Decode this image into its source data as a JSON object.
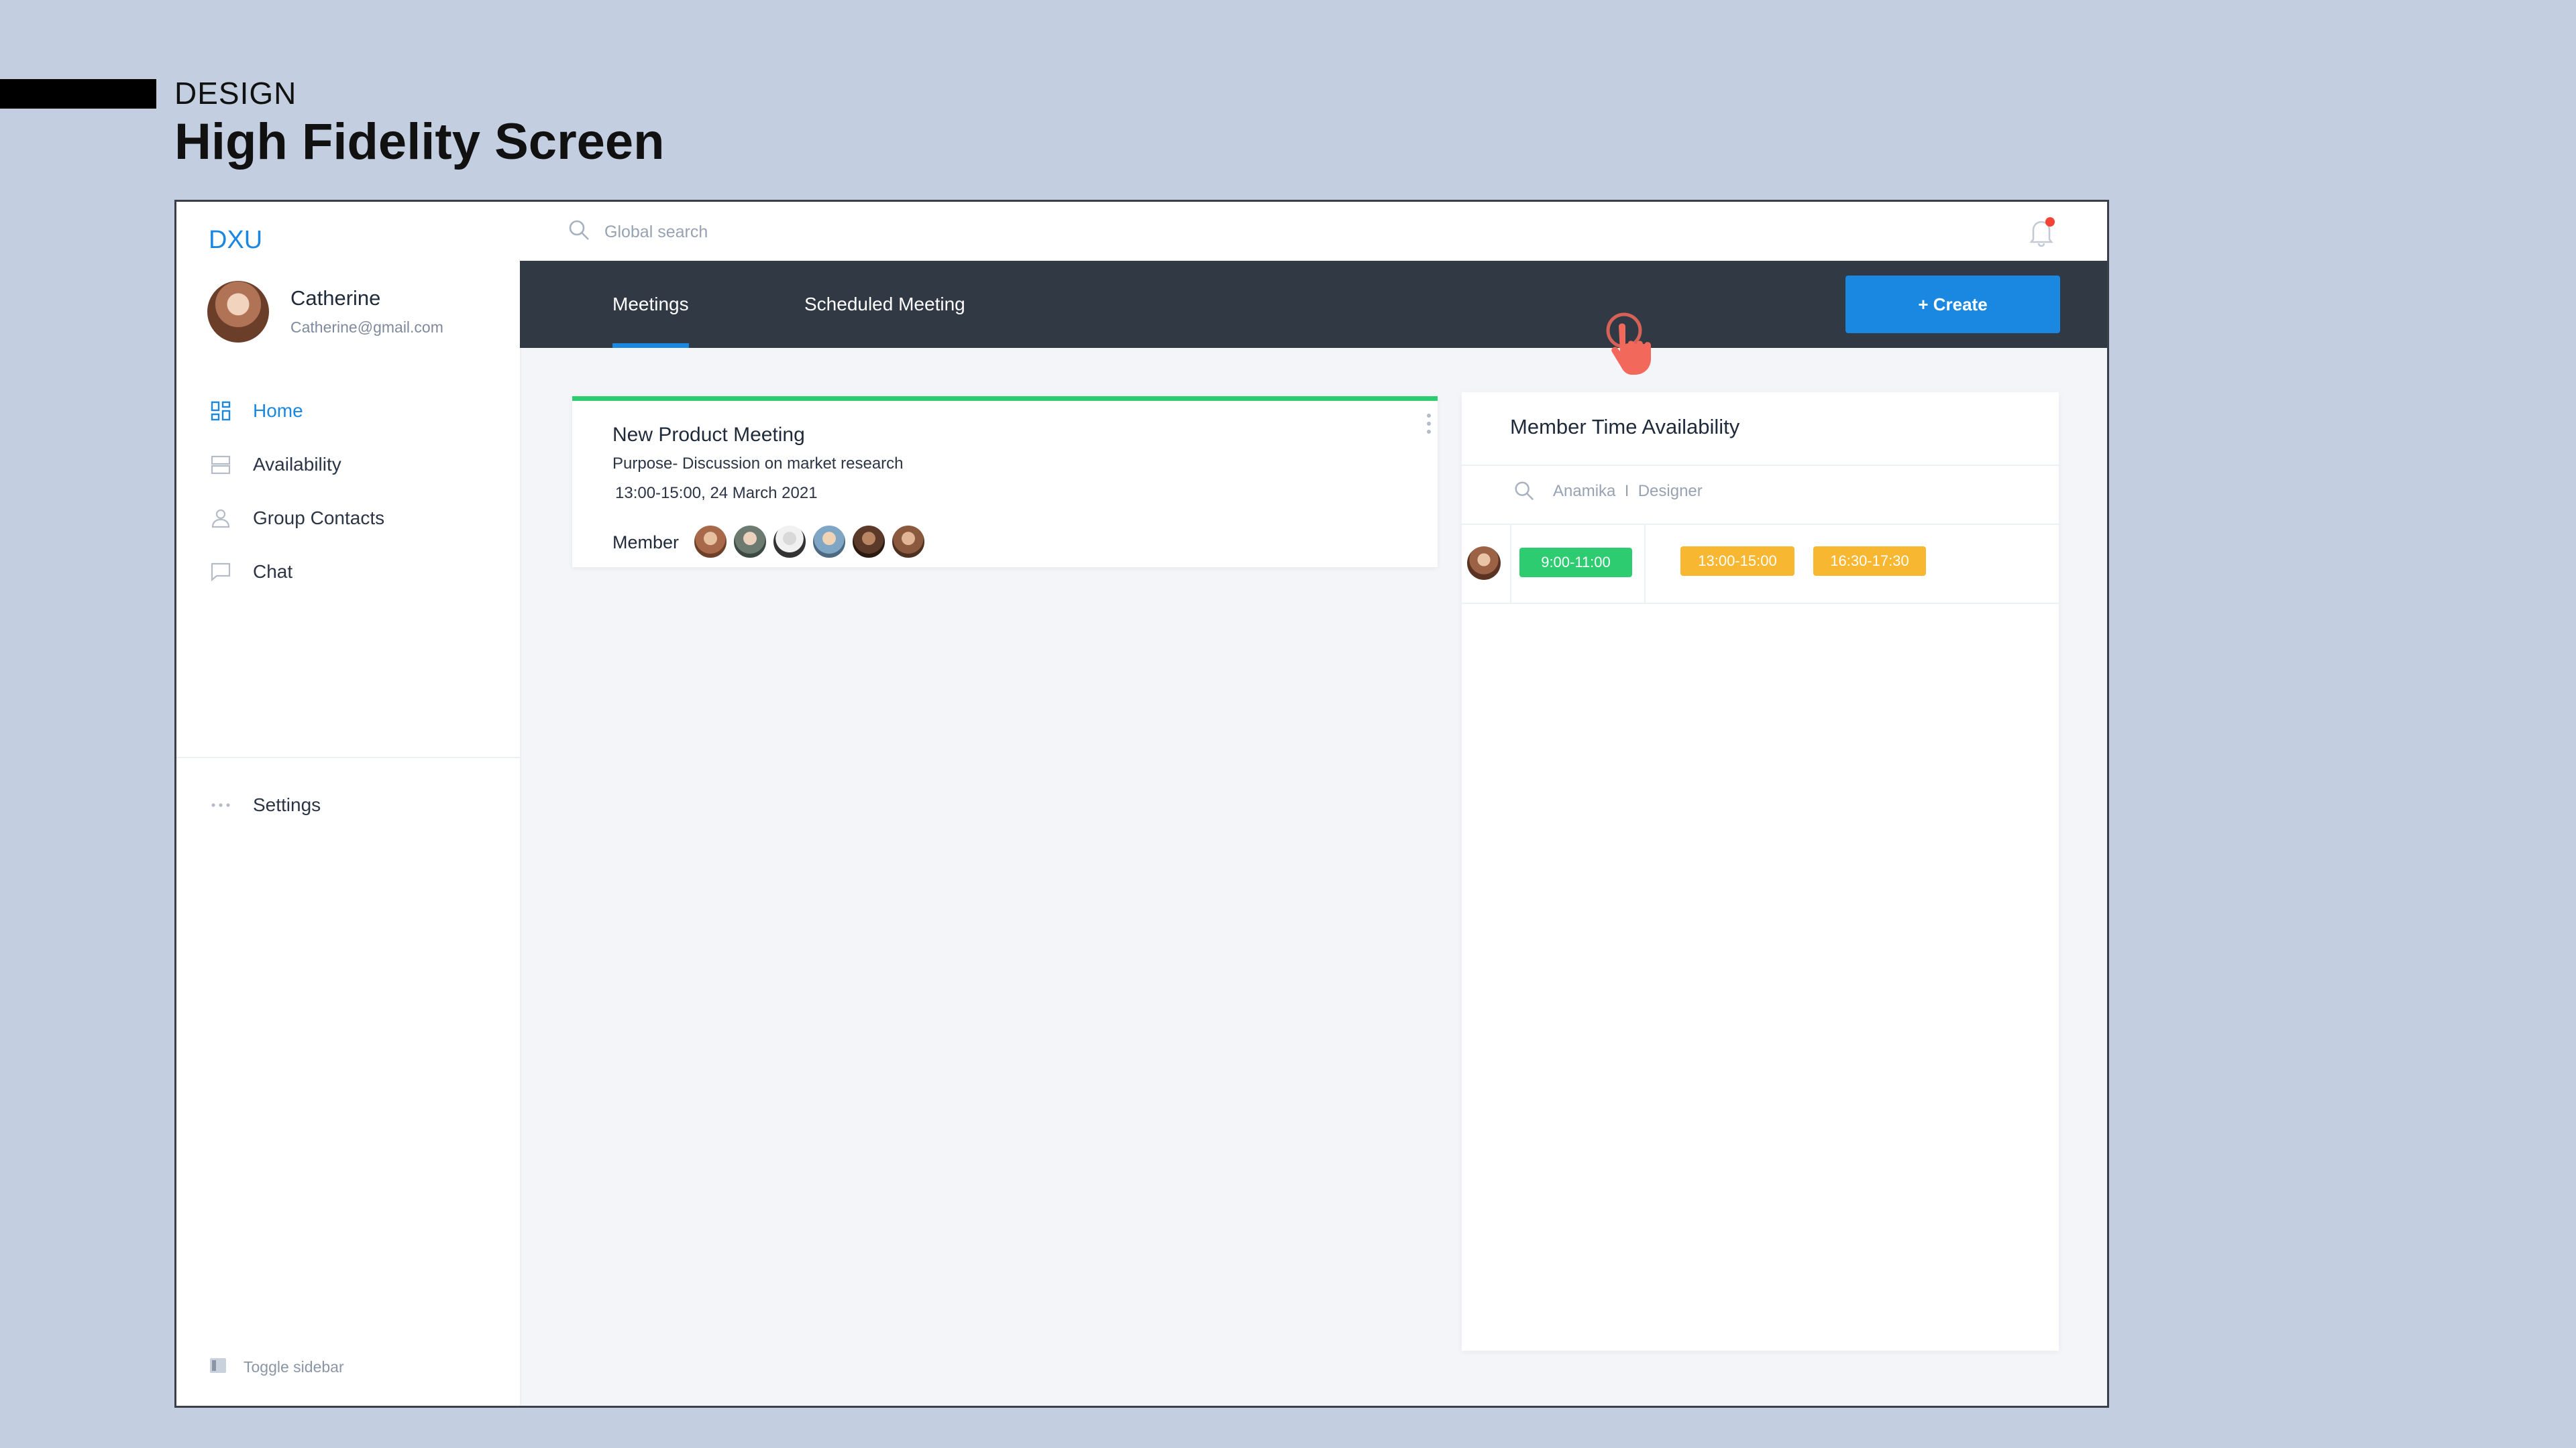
{
  "slide": {
    "section_label": "DESIGN",
    "title": "High Fidelity Screen"
  },
  "sidebar": {
    "brand": "DXU",
    "user": {
      "name": "Catherine",
      "email": "Catherine@gmail.com"
    },
    "items": [
      {
        "label": "Home",
        "icon": "home-grid-icon",
        "active": true
      },
      {
        "label": "Availability",
        "icon": "availability-icon",
        "active": false
      },
      {
        "label": "Group Contacts",
        "icon": "contacts-icon",
        "active": false
      },
      {
        "label": "Chat",
        "icon": "chat-icon",
        "active": false
      }
    ],
    "settings_label": "Settings",
    "toggle_label": "Toggle sidebar"
  },
  "topbar": {
    "search_placeholder": "Global search",
    "has_notification": true
  },
  "tabs": [
    {
      "label": "Meetings",
      "active": true
    },
    {
      "label": "Scheduled Meeting",
      "active": false
    }
  ],
  "create_button_label": "+ Create",
  "meeting": {
    "title": "New Product Meeting",
    "purpose": "Purpose- Discussion on market research",
    "time": "13:00-15:00, 24 March 2021",
    "member_label": "Member",
    "status_color": "#2ecc71"
  },
  "availability": {
    "title": "Member Time Availability",
    "search_text": "Anamika  I  Designer",
    "slots": [
      {
        "label": "9:00-11:00",
        "color": "#2ecc71"
      },
      {
        "label": "13:00-15:00",
        "color": "#f7b731"
      },
      {
        "label": "16:30-17:30",
        "color": "#f7b731"
      }
    ]
  },
  "colors": {
    "accent": "#1a88e0",
    "tabbar": "#303944",
    "available": "#2ecc71",
    "busy": "#f7b731",
    "notification": "#f44336"
  }
}
